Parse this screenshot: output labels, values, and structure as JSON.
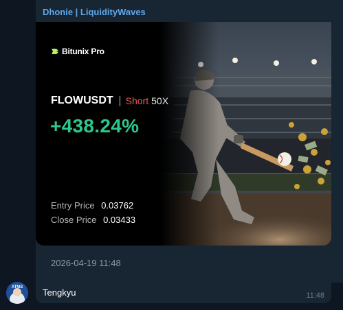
{
  "message": {
    "sender": "Dhonie | LiquidityWaves",
    "card": {
      "brand": "Bitunix Pro",
      "pair": "FLOWUSDT",
      "side": "Short",
      "leverage": "50X",
      "pnl": "+438.24%",
      "entry_label": "Entry Price",
      "entry_value": "0.03762",
      "close_label": "Close Price",
      "close_value": "0.03433"
    },
    "timestamp": "2026-04-19 11:48"
  },
  "reply": {
    "avatar_label": "ATMS",
    "text": "Tengkyu",
    "time": "11:48"
  },
  "colors": {
    "background": "#0e1621",
    "bubble": "#182533",
    "sender": "#5fa8e8",
    "pnl_green": "#2ec78b",
    "short_red": "#f05a5a"
  },
  "icons": {
    "brand": "bitunix-logo-icon",
    "avatar": "user-avatar"
  }
}
